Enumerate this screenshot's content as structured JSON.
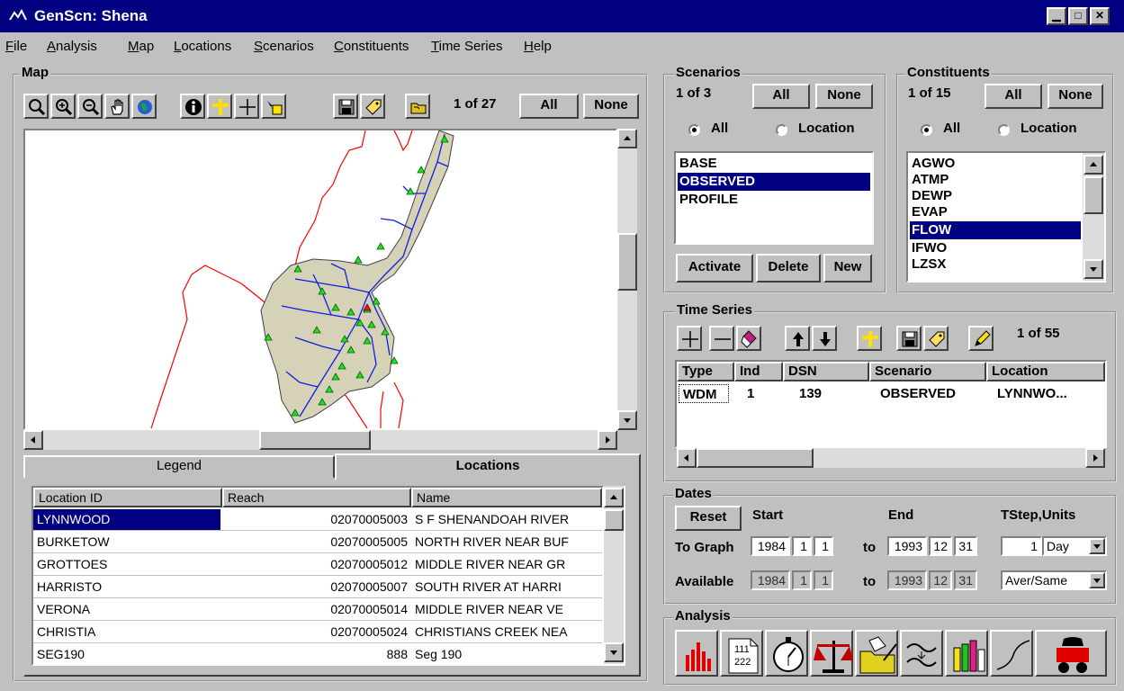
{
  "window": {
    "title": "GenScn: Shena"
  },
  "menu": [
    "File",
    "Analysis",
    "Map",
    "Locations",
    "Scenarios",
    "Constituents",
    "Time Series",
    "Help"
  ],
  "map": {
    "group_label": "Map",
    "count": "1 of 27",
    "all_label": "All",
    "none_label": "None",
    "tabs": {
      "legend": "Legend",
      "locations": "Locations"
    }
  },
  "locations": {
    "columns": [
      "Location ID",
      "Reach",
      "Name"
    ],
    "rows": [
      {
        "id": "LYNNWOOD",
        "reach": "02070005003",
        "name": "S F SHENANDOAH RIVER"
      },
      {
        "id": "BURKETOW",
        "reach": "02070005005",
        "name": "NORTH RIVER NEAR BUF"
      },
      {
        "id": "GROTTOES",
        "reach": "02070005012",
        "name": "MIDDLE RIVER NEAR GR"
      },
      {
        "id": "HARRISTO",
        "reach": "02070005007",
        "name": "SOUTH RIVER AT HARRI"
      },
      {
        "id": "VERONA",
        "reach": "02070005014",
        "name": "MIDDLE RIVER NEAR VE"
      },
      {
        "id": "CHRISTIA",
        "reach": "02070005024",
        "name": "CHRISTIANS CREEK NEA"
      },
      {
        "id": "SEG190",
        "reach": "888",
        "name": "Seg 190"
      }
    ]
  },
  "scenarios": {
    "group_label": "Scenarios",
    "count": "1 of 3",
    "all_label": "All",
    "none_label": "None",
    "radio_all": "All",
    "radio_location": "Location",
    "items": [
      "BASE",
      "OBSERVED",
      "PROFILE"
    ],
    "selected": "OBSERVED",
    "activate": "Activate",
    "delete": "Delete",
    "new": "New"
  },
  "constituents": {
    "group_label": "Constituents",
    "count": "1 of 15",
    "all_label": "All",
    "none_label": "None",
    "radio_all": "All",
    "radio_location": "Location",
    "items": [
      "AGWO",
      "ATMP",
      "DEWP",
      "EVAP",
      "FLOW",
      "IFWO",
      "LZSX"
    ],
    "selected": "FLOW"
  },
  "timeseries": {
    "group_label": "Time Series",
    "count": "1 of 55",
    "columns": [
      "Type",
      "Ind",
      "DSN",
      "Scenario",
      "Location"
    ],
    "rows": [
      {
        "type": "WDM",
        "ind": "1",
        "dsn": "139",
        "scenario": "OBSERVED",
        "location": "LYNNWO..."
      }
    ]
  },
  "dates": {
    "group_label": "Dates",
    "reset": "Reset",
    "start": "Start",
    "end": "End",
    "tstep_units": "TStep,Units",
    "to_graph": "To Graph",
    "available": "Available",
    "to": "to",
    "graph_start": {
      "y": "1984",
      "m": "1",
      "d": "1"
    },
    "graph_end": {
      "y": "1993",
      "m": "12",
      "d": "31"
    },
    "avail_start": {
      "y": "1984",
      "m": "1",
      "d": "1"
    },
    "avail_end": {
      "y": "1993",
      "m": "12",
      "d": "31"
    },
    "tstep": "1",
    "units": "Day",
    "aggregation": "Aver/Same"
  },
  "analysis": {
    "group_label": "Analysis",
    "list_icon_text": [
      "111",
      "222"
    ]
  }
}
